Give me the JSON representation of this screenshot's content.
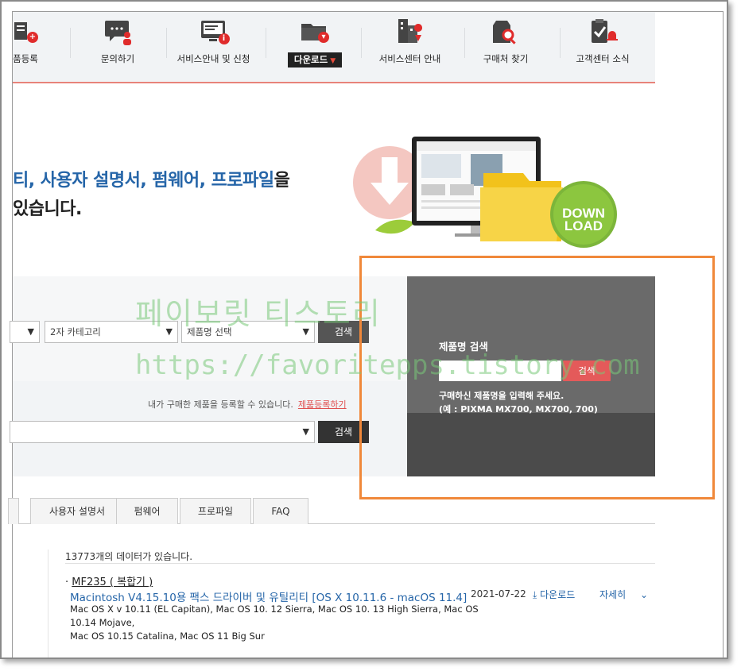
{
  "nav": {
    "items": [
      {
        "label": "품등록",
        "icon": "product-register-icon"
      },
      {
        "label": "문의하기",
        "icon": "inquiry-icon"
      },
      {
        "label": "서비스안내 및 신청",
        "icon": "service-info-icon"
      },
      {
        "label": "다운로드",
        "icon": "download-folder-icon",
        "active": true
      },
      {
        "label": "서비스센터 안내",
        "icon": "service-center-icon"
      },
      {
        "label": "구매처 찾기",
        "icon": "store-search-icon"
      },
      {
        "label": "고객센터 소식",
        "icon": "notice-icon"
      }
    ]
  },
  "hero": {
    "line1_blue_a": "티, 사용자 설명서, 펌웨어, 프로파일",
    "line1_tail": "을",
    "line2": "있습니다."
  },
  "illustration": {
    "download_text_1": "DOWN",
    "download_text_2": "LOAD"
  },
  "search": {
    "category1_value": "",
    "category2_value": "2자 카테고리",
    "product_select_value": "제품명 선택",
    "search_button": "검색",
    "register_text": "내가 구매한 제품을 등록할 수 있습니다.",
    "register_link": "제품등록하기",
    "my_product_value": "",
    "search_button2": "검색"
  },
  "side": {
    "title": "제품명 검색",
    "input_value": "",
    "button": "검색",
    "help1": "구매하신 제품명을 입력해 주세요.",
    "help2": "(예 : PIXMA MX700, MX700, 700)"
  },
  "watermark": {
    "line1": "페이보릿 티스토리",
    "line2": "https://favoritepps.tistory.com"
  },
  "tabs": [
    "사용자 설명서",
    "펌웨어",
    "프로파일",
    "FAQ"
  ],
  "results": {
    "count": "13773개의 데이터가 있습니다.",
    "items": [
      {
        "model_prefix": "· ",
        "model": "MF235 ( 복합기 )",
        "title": "Macintosh V4.15.10용 팩스 드라이버 및 유틸리티 [OS X 10.11.6 - macOS 11.4]",
        "date": "2021-07-22",
        "download": "다운로드",
        "more": "자세히",
        "os1": "Mac OS X v 10.11 (EL Capitan), Mac OS 10. 12 Sierra, Mac OS 10. 13 High Sierra, Mac OS",
        "os2": "10.14 Mojave,",
        "os3": "Mac OS 10.15 Catalina, Mac OS 11 Big Sur"
      }
    ]
  },
  "colors": {
    "accent_red": "#e64b3b",
    "link_blue": "#2565a8",
    "highlight_orange": "#f0883a"
  }
}
